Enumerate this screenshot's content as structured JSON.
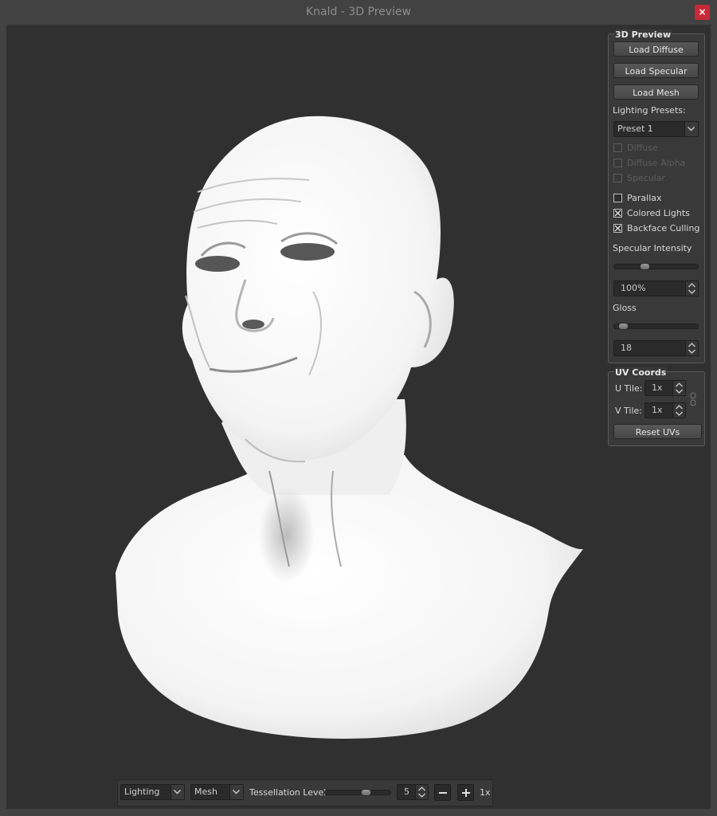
{
  "window": {
    "title": "Knald - 3D Preview",
    "close_glyph": "×"
  },
  "panel": {
    "title": "3D Preview",
    "load_diffuse": "Load Diffuse",
    "load_specular": "Load Specular",
    "load_mesh": "Load Mesh",
    "lighting_presets_label": "Lighting Presets:",
    "lighting_preset_value": "Preset 1",
    "checkboxes": [
      {
        "label": "Diffuse",
        "checked": false,
        "enabled": false
      },
      {
        "label": "Diffuse Alpha",
        "checked": false,
        "enabled": false
      },
      {
        "label": "Specular",
        "checked": false,
        "enabled": false
      },
      {
        "label": "Parallax",
        "checked": false,
        "enabled": true
      },
      {
        "label": "Colored Lights",
        "checked": true,
        "enabled": true
      },
      {
        "label": "Backface Culling",
        "checked": true,
        "enabled": true
      }
    ],
    "specular_intensity_label": "Specular Intensity",
    "specular_intensity_value": "100%",
    "specular_intensity_level": 0.35,
    "gloss_label": "Gloss",
    "gloss_value": "18",
    "gloss_level": 0.05
  },
  "uv": {
    "title": "UV Coords",
    "u_label": "U Tile:",
    "u_value": "1x",
    "v_label": "V Tile:",
    "v_value": "1x",
    "reset": "Reset UVs"
  },
  "toolbar": {
    "view_mode": "Lighting",
    "display_mode": "Mesh",
    "tess_label": "Tessellation Level:",
    "tess_level": 0.65,
    "tess_value": "5",
    "zoom_value": "1x"
  },
  "colors": {
    "background": "#303030",
    "close_button": "#c62a36",
    "mesh": "#f2f2f2"
  }
}
